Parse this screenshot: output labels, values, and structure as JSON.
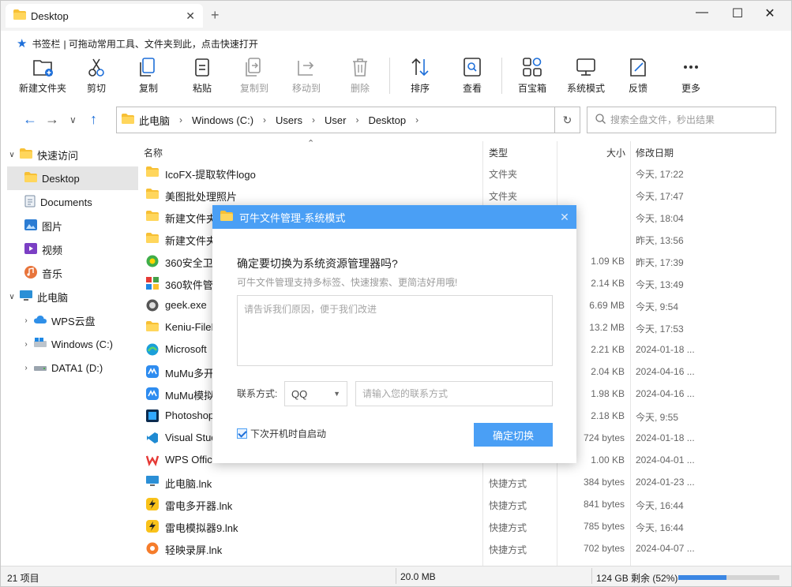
{
  "window": {
    "tab_title": "Desktop",
    "new_tab": "+",
    "minimize": "—",
    "maximize": "☐",
    "close": "✕"
  },
  "bookmark": {
    "label": "书签栏",
    "hint": "| 可拖动常用工具、文件夹到此，点击快速打开"
  },
  "toolbar": [
    {
      "label": "新建文件夹",
      "icon": "new-folder-icon",
      "disabled": false
    },
    {
      "label": "剪切",
      "icon": "cut-icon",
      "disabled": false
    },
    {
      "label": "复制",
      "icon": "copy-icon",
      "disabled": false
    },
    {
      "label": "粘贴",
      "icon": "paste-icon",
      "disabled": false
    },
    {
      "label": "复制到",
      "icon": "copy-to-icon",
      "disabled": true
    },
    {
      "label": "移动到",
      "icon": "move-to-icon",
      "disabled": true
    },
    {
      "label": "删除",
      "icon": "delete-icon",
      "disabled": true
    },
    {
      "label": "排序",
      "icon": "sort-icon",
      "disabled": false
    },
    {
      "label": "查看",
      "icon": "view-icon",
      "disabled": false
    },
    {
      "label": "百宝箱",
      "icon": "toolbox-icon",
      "disabled": false
    },
    {
      "label": "系统模式",
      "icon": "system-mode-icon",
      "disabled": false
    },
    {
      "label": "反馈",
      "icon": "feedback-icon",
      "disabled": false
    },
    {
      "label": "更多",
      "icon": "more-icon",
      "disabled": false
    }
  ],
  "address": {
    "segments": [
      "此电脑",
      "Windows (C:)",
      "Users",
      "User",
      "Desktop"
    ]
  },
  "search": {
    "placeholder": "搜索全盘文件，秒出结果"
  },
  "sidebar": {
    "quick_access": "快速访问",
    "items": [
      "Desktop",
      "Documents",
      "图片",
      "视频",
      "音乐"
    ],
    "this_pc": "此电脑",
    "drives": [
      "WPS云盘",
      "Windows (C:)",
      "DATA1 (D:)"
    ]
  },
  "columns": {
    "name": "名称",
    "type": "类型",
    "size": "大小",
    "date": "修改日期"
  },
  "files": [
    {
      "name": "IcoFX-提取软件logo",
      "type": "文件夹",
      "size": "",
      "date": "今天, 17:22",
      "icon": "folder-icon"
    },
    {
      "name": "美图批处理照片",
      "type": "文件夹",
      "size": "",
      "date": "今天, 17:47",
      "icon": "folder-icon"
    },
    {
      "name": "新建文件夹",
      "type": "",
      "size": "",
      "date": "今天, 18:04",
      "icon": "folder-icon"
    },
    {
      "name": "新建文件夹",
      "type": "",
      "size": "",
      "date": "昨天, 13:56",
      "icon": "folder-icon"
    },
    {
      "name": "360安全卫士",
      "type": "",
      "size": "1.09 KB",
      "date": "昨天, 17:39",
      "icon": "shortcut-360-icon"
    },
    {
      "name": "360软件管家",
      "type": "",
      "size": "2.14 KB",
      "date": "今天, 13:49",
      "icon": "shortcut-360soft-icon"
    },
    {
      "name": "geek.exe",
      "type": "",
      "size": "6.69 MB",
      "date": "今天, 9:54",
      "icon": "exe-icon"
    },
    {
      "name": "Keniu-FileM",
      "type": "",
      "size": "13.2 MB",
      "date": "今天, 17:53",
      "icon": "folder-icon"
    },
    {
      "name": "Microsoft",
      "type": "",
      "size": "2.21 KB",
      "date": "2024-01-18 ...",
      "icon": "edge-icon"
    },
    {
      "name": "MuMu多开",
      "type": "",
      "size": "2.04 KB",
      "date": "2024-04-16 ...",
      "icon": "mumu-icon"
    },
    {
      "name": "MuMu模拟",
      "type": "",
      "size": "1.98 KB",
      "date": "2024-04-16 ...",
      "icon": "mumu-icon"
    },
    {
      "name": "Photoshop",
      "type": "",
      "size": "2.18 KB",
      "date": "今天, 9:55",
      "icon": "photoshop-icon"
    },
    {
      "name": "Visual Stuc",
      "type": "",
      "size": "724 bytes",
      "date": "2024-01-18 ...",
      "icon": "vscode-icon"
    },
    {
      "name": "WPS Office....",
      "type": "",
      "size": "1.00 KB",
      "date": "2024-04-01 ...",
      "icon": "wps-icon"
    },
    {
      "name": "此电脑.lnk",
      "type": "快捷方式",
      "size": "384 bytes",
      "date": "2024-01-23 ...",
      "icon": "pc-icon"
    },
    {
      "name": "雷电多开器.lnk",
      "type": "快捷方式",
      "size": "841 bytes",
      "date": "今天, 16:44",
      "icon": "leidian-icon"
    },
    {
      "name": "雷电模拟器9.lnk",
      "type": "快捷方式",
      "size": "785 bytes",
      "date": "今天, 16:44",
      "icon": "leidian-icon"
    },
    {
      "name": "轻映录屏.lnk",
      "type": "快捷方式",
      "size": "702 bytes",
      "date": "2024-04-07 ...",
      "icon": "recorder-icon"
    }
  ],
  "status": {
    "count": "21 项目",
    "size": "20.0 MB",
    "free": "124 GB 剩余 (52%)",
    "used_fraction": 0.48
  },
  "dialog": {
    "title": "可牛文件管理-系统模式",
    "close": "✕",
    "question": "确定要切换为系统资源管理器吗?",
    "subtitle": "可牛文件管理支持多标签、快速搜索、更简洁好用哦!",
    "reason_placeholder": "请告诉我们原因，便于我们改进",
    "contact_label": "联系方式:",
    "contact_type": "QQ",
    "contact_placeholder": "请输入您的联系方式",
    "autostart_label": "下次开机时自启动",
    "confirm": "确定切换"
  }
}
